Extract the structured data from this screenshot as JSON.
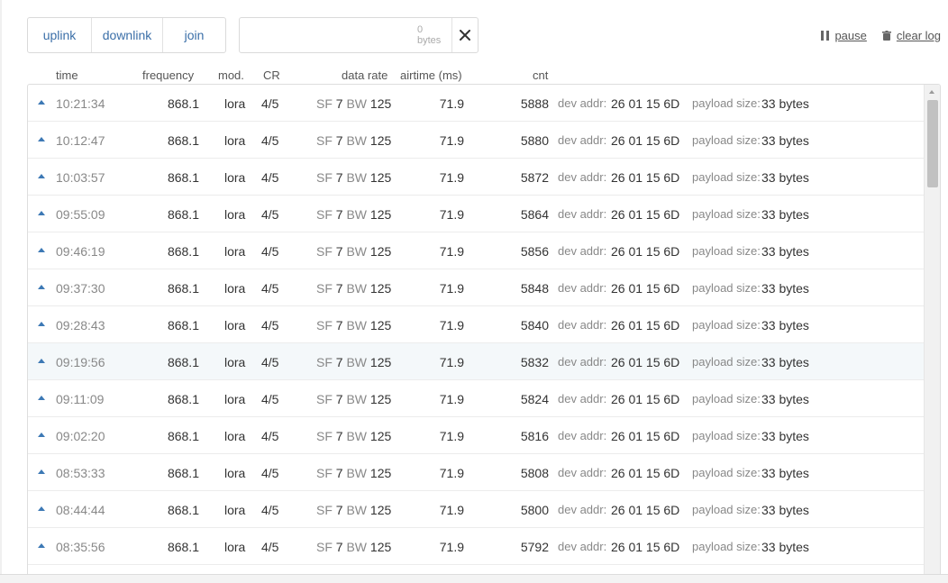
{
  "filters": [
    {
      "name": "uplink",
      "label": "uplink"
    },
    {
      "name": "downlink",
      "label": "downlink"
    },
    {
      "name": "join",
      "label": "join"
    }
  ],
  "search": {
    "value": "",
    "placeholder": "",
    "byte_count": "0 bytes",
    "clear_icon": "close-icon"
  },
  "actions": {
    "pause_label": "pause",
    "clear_label": "clear log",
    "pause_icon": "pause-icon",
    "clear_icon": "trash-icon"
  },
  "columns": {
    "time": "time",
    "frequency": "frequency",
    "modulation": "mod.",
    "coding_rate": "CR",
    "data_rate": "data rate",
    "airtime": "airtime (ms)",
    "count": "cnt"
  },
  "row_labels": {
    "sf": "SF",
    "bw": "BW",
    "dev_addr": "dev addr:",
    "payload_size": "payload size:"
  },
  "colors": {
    "accent": "#3b6fa8",
    "uplink_arrow": "#3d79b5",
    "highlight_row": "#f4f8fa"
  },
  "highlighted_row_index": 7,
  "rows": [
    {
      "direction": "uplink-arrow-icon",
      "time": "10:21:34",
      "frequency": "868.1",
      "modulation": "lora",
      "coding_rate": "4/5",
      "sf": "7",
      "bw": "125",
      "airtime": "71.9",
      "count": "5888",
      "dev_addr": "26 01 15 6D",
      "payload_size": "33 bytes"
    },
    {
      "direction": "uplink-arrow-icon",
      "time": "10:12:47",
      "frequency": "868.1",
      "modulation": "lora",
      "coding_rate": "4/5",
      "sf": "7",
      "bw": "125",
      "airtime": "71.9",
      "count": "5880",
      "dev_addr": "26 01 15 6D",
      "payload_size": "33 bytes"
    },
    {
      "direction": "uplink-arrow-icon",
      "time": "10:03:57",
      "frequency": "868.1",
      "modulation": "lora",
      "coding_rate": "4/5",
      "sf": "7",
      "bw": "125",
      "airtime": "71.9",
      "count": "5872",
      "dev_addr": "26 01 15 6D",
      "payload_size": "33 bytes"
    },
    {
      "direction": "uplink-arrow-icon",
      "time": "09:55:09",
      "frequency": "868.1",
      "modulation": "lora",
      "coding_rate": "4/5",
      "sf": "7",
      "bw": "125",
      "airtime": "71.9",
      "count": "5864",
      "dev_addr": "26 01 15 6D",
      "payload_size": "33 bytes"
    },
    {
      "direction": "uplink-arrow-icon",
      "time": "09:46:19",
      "frequency": "868.1",
      "modulation": "lora",
      "coding_rate": "4/5",
      "sf": "7",
      "bw": "125",
      "airtime": "71.9",
      "count": "5856",
      "dev_addr": "26 01 15 6D",
      "payload_size": "33 bytes"
    },
    {
      "direction": "uplink-arrow-icon",
      "time": "09:37:30",
      "frequency": "868.1",
      "modulation": "lora",
      "coding_rate": "4/5",
      "sf": "7",
      "bw": "125",
      "airtime": "71.9",
      "count": "5848",
      "dev_addr": "26 01 15 6D",
      "payload_size": "33 bytes"
    },
    {
      "direction": "uplink-arrow-icon",
      "time": "09:28:43",
      "frequency": "868.1",
      "modulation": "lora",
      "coding_rate": "4/5",
      "sf": "7",
      "bw": "125",
      "airtime": "71.9",
      "count": "5840",
      "dev_addr": "26 01 15 6D",
      "payload_size": "33 bytes"
    },
    {
      "direction": "uplink-arrow-icon",
      "time": "09:19:56",
      "frequency": "868.1",
      "modulation": "lora",
      "coding_rate": "4/5",
      "sf": "7",
      "bw": "125",
      "airtime": "71.9",
      "count": "5832",
      "dev_addr": "26 01 15 6D",
      "payload_size": "33 bytes"
    },
    {
      "direction": "uplink-arrow-icon",
      "time": "09:11:09",
      "frequency": "868.1",
      "modulation": "lora",
      "coding_rate": "4/5",
      "sf": "7",
      "bw": "125",
      "airtime": "71.9",
      "count": "5824",
      "dev_addr": "26 01 15 6D",
      "payload_size": "33 bytes"
    },
    {
      "direction": "uplink-arrow-icon",
      "time": "09:02:20",
      "frequency": "868.1",
      "modulation": "lora",
      "coding_rate": "4/5",
      "sf": "7",
      "bw": "125",
      "airtime": "71.9",
      "count": "5816",
      "dev_addr": "26 01 15 6D",
      "payload_size": "33 bytes"
    },
    {
      "direction": "uplink-arrow-icon",
      "time": "08:53:33",
      "frequency": "868.1",
      "modulation": "lora",
      "coding_rate": "4/5",
      "sf": "7",
      "bw": "125",
      "airtime": "71.9",
      "count": "5808",
      "dev_addr": "26 01 15 6D",
      "payload_size": "33 bytes"
    },
    {
      "direction": "uplink-arrow-icon",
      "time": "08:44:44",
      "frequency": "868.1",
      "modulation": "lora",
      "coding_rate": "4/5",
      "sf": "7",
      "bw": "125",
      "airtime": "71.9",
      "count": "5800",
      "dev_addr": "26 01 15 6D",
      "payload_size": "33 bytes"
    },
    {
      "direction": "uplink-arrow-icon",
      "time": "08:35:56",
      "frequency": "868.1",
      "modulation": "lora",
      "coding_rate": "4/5",
      "sf": "7",
      "bw": "125",
      "airtime": "71.9",
      "count": "5792",
      "dev_addr": "26 01 15 6D",
      "payload_size": "33 bytes"
    }
  ]
}
